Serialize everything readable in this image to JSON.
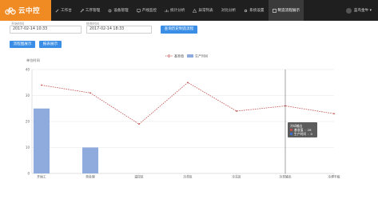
{
  "app": {
    "logo_text": "云中控"
  },
  "nav": {
    "items": [
      {
        "label": "工作台"
      },
      {
        "label": "工序管理"
      },
      {
        "label": "设备管理"
      },
      {
        "label": "产线监控"
      },
      {
        "label": "统计分析"
      },
      {
        "label": "异常列表"
      },
      {
        "label": "对比分析"
      },
      {
        "label": "系统设置"
      },
      {
        "label": "制造流程展示"
      }
    ],
    "user": "蓝鸟金牛 ▾"
  },
  "filters": {
    "start_label": "开始时间",
    "start_value": "2017-02-14 10:33",
    "end_label": "结束时间",
    "end_value": "2017-02-14 18:33",
    "query_button": "查询历史制造流程",
    "btn_flow": "流程图展示",
    "btn_report": "报表展示"
  },
  "colors": {
    "accent": "#3a8ee6",
    "logo": "#f08a22",
    "nav_bg": "#1f1f1f",
    "line": "#c0504d",
    "bar": "#8faadc"
  },
  "chart_data": {
    "type": "bar",
    "ylabel": "单位时间",
    "categories": [
      "开始工",
      "热处理",
      "温控区",
      "冷却区",
      "冷冻区",
      "冷却输出",
      "冷焊平板"
    ],
    "ylim": [
      0,
      40
    ],
    "yticks": [
      0,
      10,
      20,
      30,
      40
    ],
    "legend_position": "top-center",
    "series": [
      {
        "name": "基准值",
        "kind": "line",
        "color": "#c0504d",
        "values": [
          34,
          31,
          19,
          35,
          24,
          26,
          23
        ]
      },
      {
        "name": "生产时间",
        "kind": "bar",
        "color": "#8faadc",
        "values": [
          25,
          10,
          0,
          0,
          0,
          0,
          0
        ]
      }
    ],
    "tooltip": {
      "title": "冷却输出",
      "rows": [
        {
          "name": "基准值",
          "value": "26",
          "color": "#c0504d"
        },
        {
          "name": "生产时间",
          "value": "0",
          "color": "#3a6fd0"
        }
      ]
    }
  }
}
